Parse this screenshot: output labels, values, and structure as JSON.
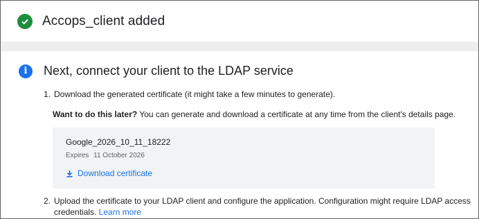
{
  "success": {
    "title": "Accops_client added",
    "icon": "check-circle-icon",
    "color": "#1e8e3e"
  },
  "info": {
    "icon": "info-icon",
    "title": "Next, connect your client to the LDAP service",
    "color": "#1a73e8"
  },
  "steps": {
    "step1_num": "1.",
    "step1_text": "Download the generated certificate (it might take a few minutes to generate).",
    "later_bold": "Want to do this later?",
    "later_text": " You can generate and download a certificate at any time from the client's details page.",
    "certificate": {
      "name": "Google_2026_10_11_18222",
      "expires_label": "Expires",
      "expires_date": "11 October 2026",
      "download_icon": "download-icon",
      "download_label": "Download certificate"
    },
    "step2_num": "2.",
    "step2_text": "Upload the certificate to your LDAP client and configure the application. Configuration might require LDAP access credentials. ",
    "step2_link": "Learn more"
  }
}
